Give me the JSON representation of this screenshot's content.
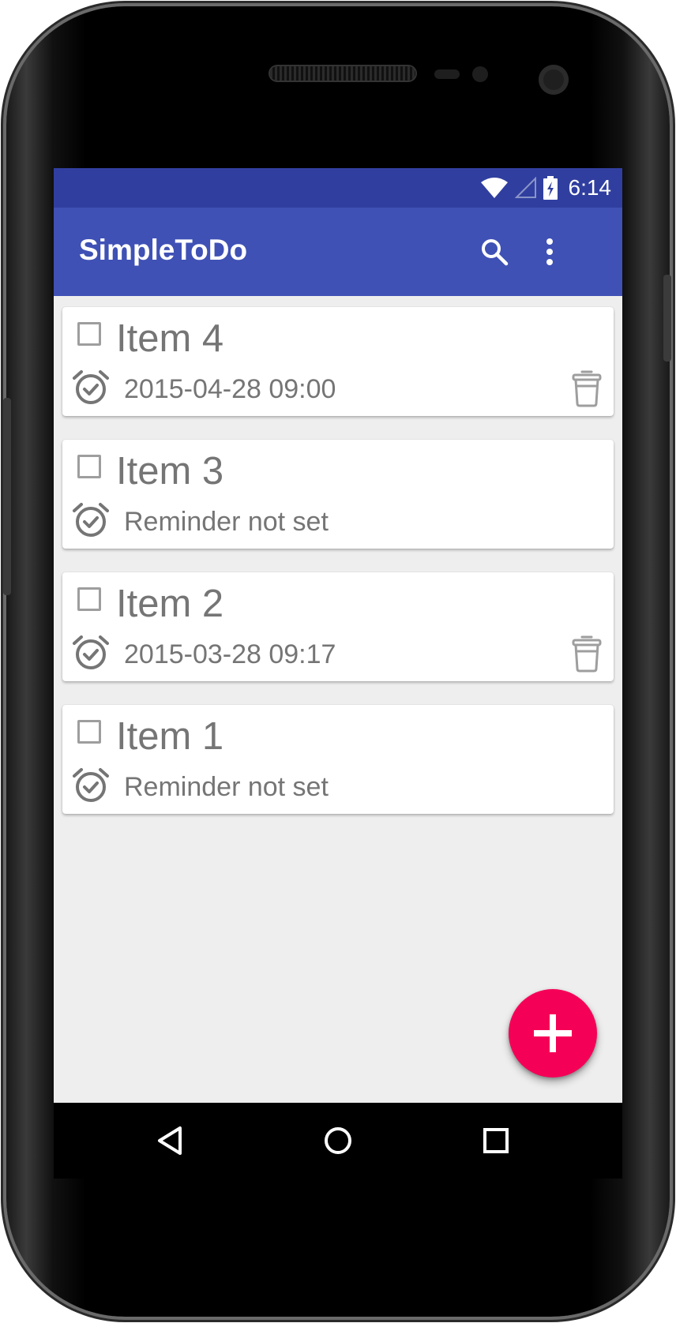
{
  "status_bar": {
    "time": "6:14",
    "icons": [
      "wifi-icon",
      "cell-signal-icon",
      "battery-charging-icon"
    ]
  },
  "app_bar": {
    "title": "SimpleToDo",
    "actions": [
      "search-icon",
      "overflow-menu-icon"
    ]
  },
  "items": [
    {
      "title": "Item 4",
      "reminder": "2015-04-28 09:00",
      "has_delete": true,
      "checked": false
    },
    {
      "title": "Item 3",
      "reminder": "Reminder not set",
      "has_delete": false,
      "checked": false
    },
    {
      "title": "Item 2",
      "reminder": "2015-03-28 09:17",
      "has_delete": true,
      "checked": false
    },
    {
      "title": "Item 1",
      "reminder": "Reminder not set",
      "has_delete": false,
      "checked": false
    }
  ],
  "fab": {
    "icon": "plus-icon"
  },
  "nav_bar": {
    "icons": [
      "back-icon",
      "home-icon",
      "recents-icon"
    ]
  },
  "colors": {
    "primary": "#3f51b5",
    "primary_dark": "#303f9f",
    "accent": "#f50057",
    "background": "#eeeeee",
    "text_secondary": "#757575"
  }
}
